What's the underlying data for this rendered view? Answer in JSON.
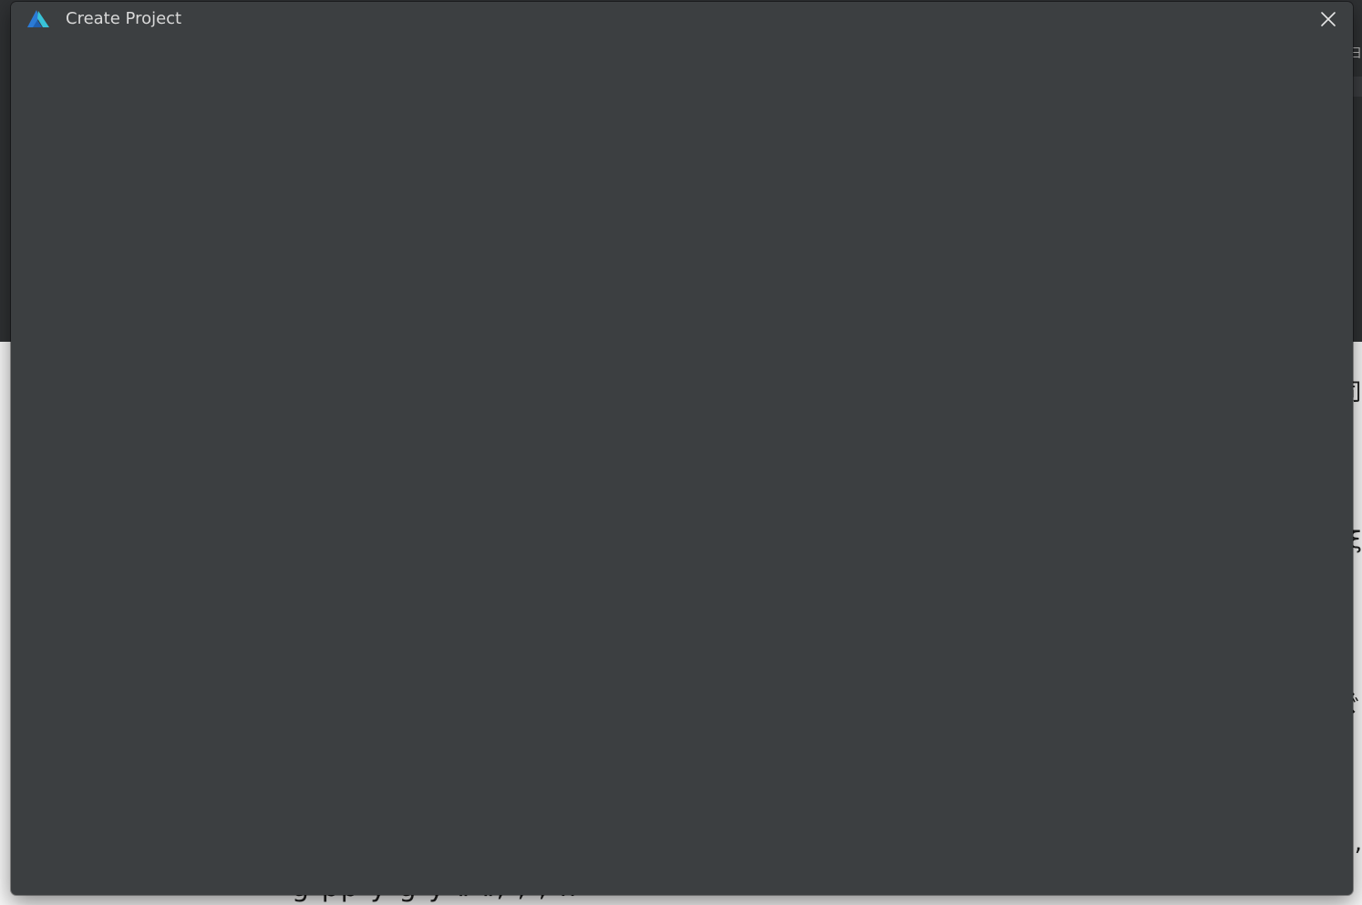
{
  "dialog": {
    "title": "Create Project",
    "close_icon": "close-icon",
    "logo_icon": "app-logo-icon"
  },
  "background": {
    "glyphs": [
      "日",
      "司",
      "ξ",
      "ぐ",
      ","
    ],
    "bottom_text": "g   pp          y           g           y  ⅱ  ⅱ,  ,   ,  ll"
  },
  "colors": {
    "dialog_bg": "#3c3f41",
    "title_text": "#d9d9d9",
    "logo_blue": "#2b7bd6",
    "logo_cyan": "#38c3d8"
  }
}
